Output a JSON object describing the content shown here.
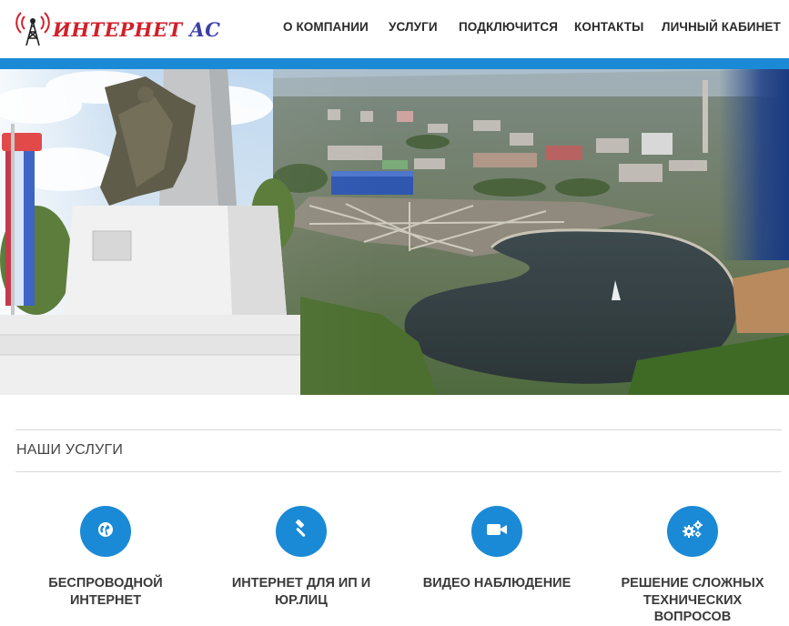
{
  "header": {
    "logo": {
      "text_part1": "ИНТЕРНЕТ",
      "text_part2": "AC"
    },
    "nav": [
      {
        "label": "О КОМПАНИИ"
      },
      {
        "label": "УСЛУГИ"
      },
      {
        "label": "ПОДКЛЮЧИТСЯ"
      },
      {
        "label": "КОНТАКТЫ"
      },
      {
        "label": "ЛИЧНЫЙ КАБИНЕТ"
      }
    ]
  },
  "colors": {
    "accent": "#1b8ad6",
    "logo_red": "#d0202a",
    "logo_blue": "#3b3fa8"
  },
  "services": {
    "title": "НАШИ УСЛУГИ",
    "items": [
      {
        "icon": "globe-icon",
        "label_line1": "БЕСПРОВОДНОЙ",
        "label_line2": "ИНТЕРНЕТ",
        "label_line3": ""
      },
      {
        "icon": "gavel-icon",
        "label_line1": "ИНТЕРНЕТ ДЛЯ ИП И",
        "label_line2": "ЮР.ЛИЦ",
        "label_line3": ""
      },
      {
        "icon": "video-camera-icon",
        "label_line1": "ВИДЕО НАБЛЮДЕНИЕ",
        "label_line2": "",
        "label_line3": ""
      },
      {
        "icon": "gears-icon",
        "label_line1": "РЕШЕНИЕ СЛОЖНЫХ",
        "label_line2": "ТЕХНИЧЕСКИХ",
        "label_line3": "ВОПРОСОВ"
      }
    ]
  }
}
